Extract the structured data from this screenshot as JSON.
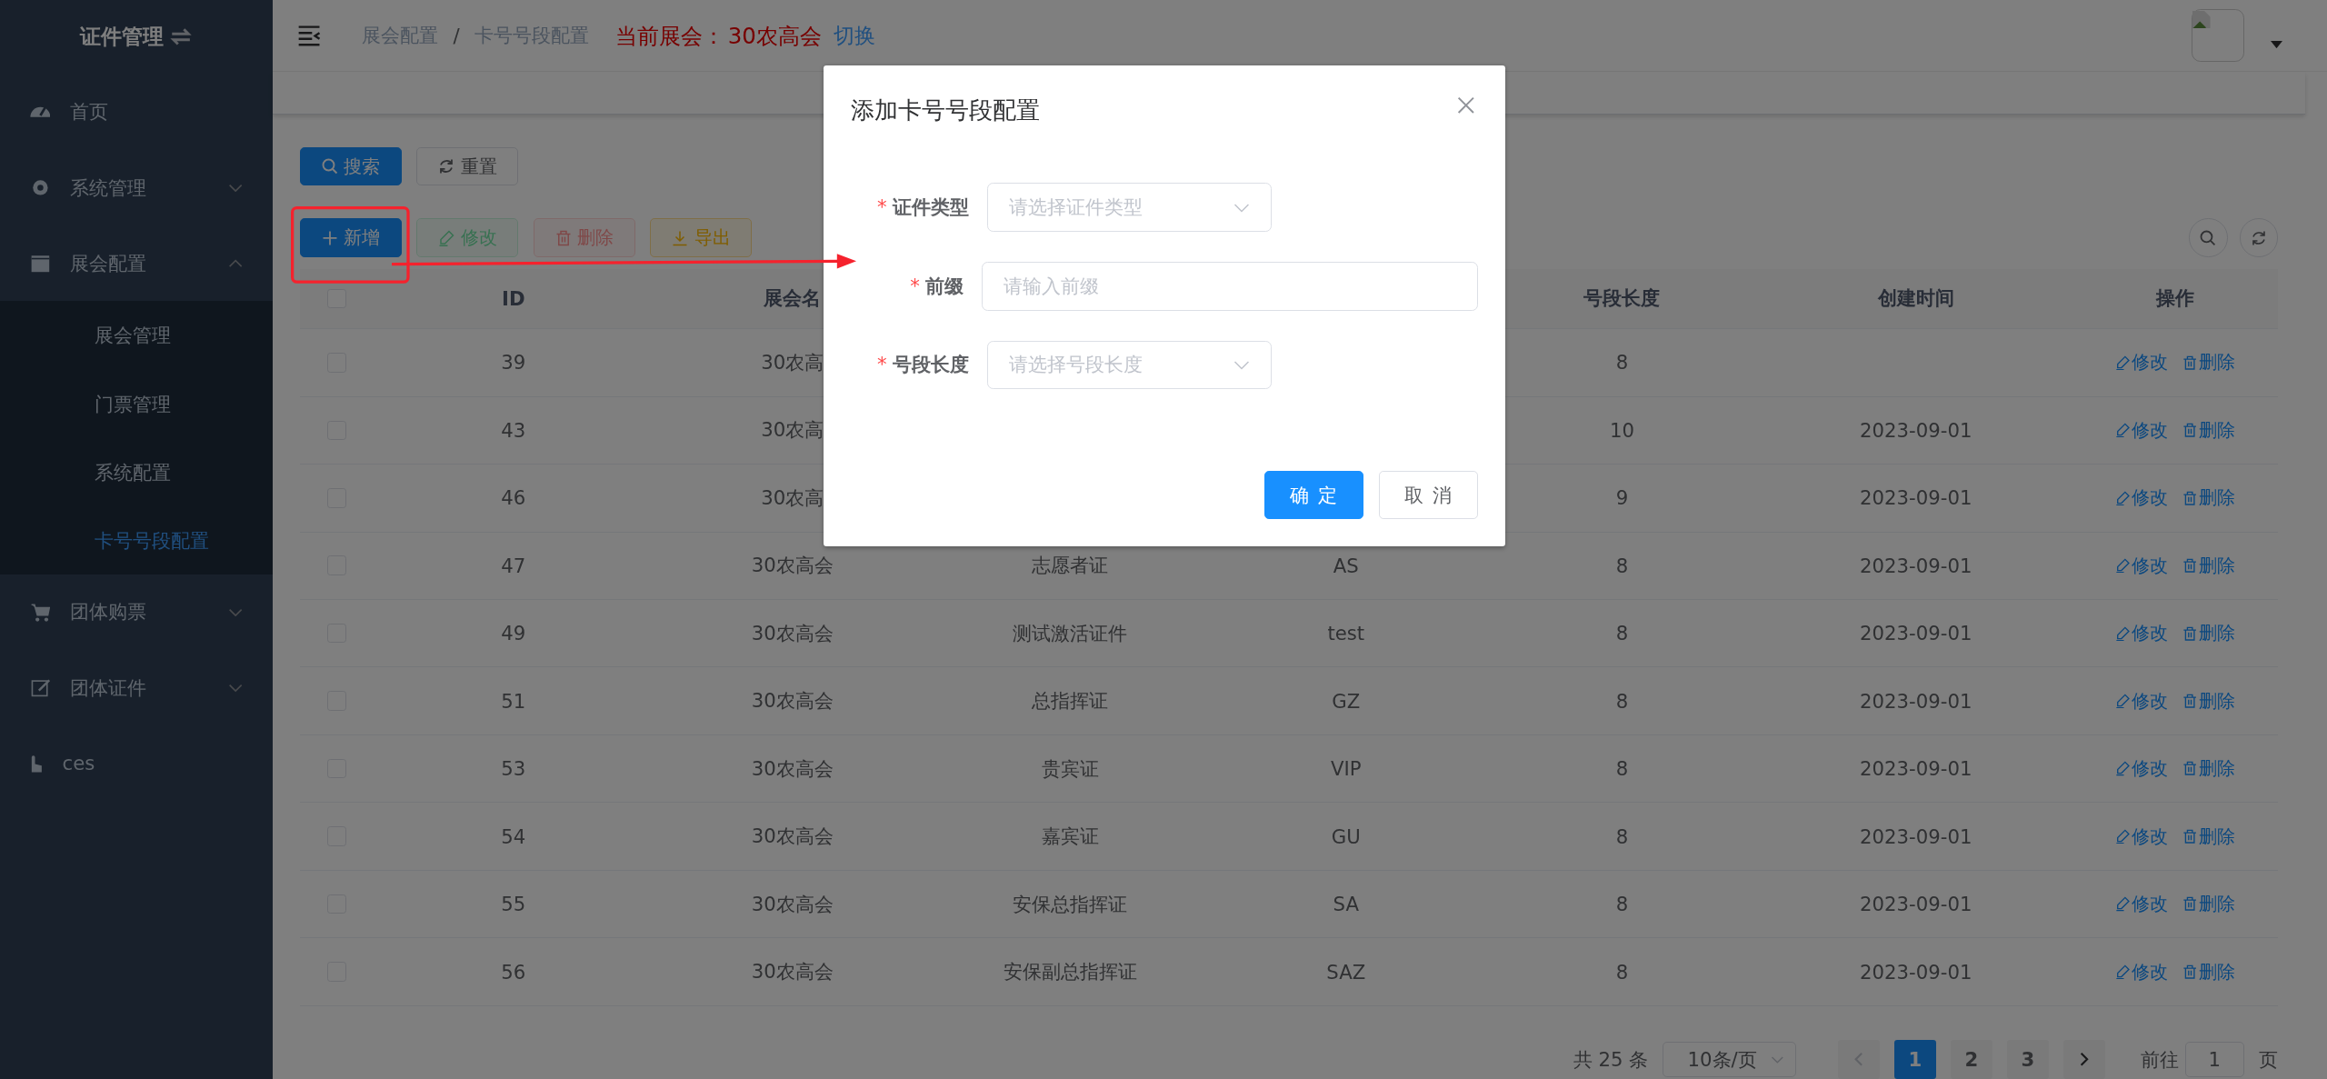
{
  "sidebar": {
    "title": "证件管理",
    "items": [
      {
        "label": "首页",
        "selected": false
      },
      {
        "label": "系统管理",
        "expanded": false,
        "selected": false
      },
      {
        "label": "展会配置",
        "expanded": true,
        "selected": false,
        "children": [
          {
            "label": "展会管理",
            "selected": false
          },
          {
            "label": "门票管理",
            "selected": false
          },
          {
            "label": "系统配置",
            "selected": false
          },
          {
            "label": "卡号号段配置",
            "selected": true
          }
        ]
      },
      {
        "label": "团体购票",
        "expanded": false,
        "selected": false
      },
      {
        "label": "团体证件",
        "expanded": false,
        "selected": false
      },
      {
        "label": "ces",
        "selected": false
      }
    ]
  },
  "header": {
    "breadcrumb": [
      "展会配置",
      "卡号号段配置"
    ],
    "breadcrumb_separator": "/",
    "current_label": "当前展会：",
    "current_value": "30农高会",
    "switch_link": "切换"
  },
  "search_buttons": [
    {
      "label": "搜索",
      "kind": "primary"
    },
    {
      "label": "重置",
      "kind": "default"
    }
  ],
  "toolbar_buttons": [
    {
      "label": "新增",
      "kind": "primary",
      "disabled": false
    },
    {
      "label": "修改",
      "kind": "success",
      "disabled": true
    },
    {
      "label": "删除",
      "kind": "danger",
      "disabled": true
    },
    {
      "label": "导出",
      "kind": "warning",
      "disabled": false
    }
  ],
  "table": {
    "select_all_checked": false,
    "headers": {
      "id": "ID",
      "exhibition": "展会名",
      "length": "号段长度",
      "created": "创建时间",
      "actions": "操作"
    },
    "rows": [
      {
        "checked": false,
        "id": "39",
        "exhibition": "30农高",
        "length": "8",
        "actions": [
          "修改",
          "删除"
        ]
      },
      {
        "checked": false,
        "id": "43",
        "exhibition": "30农高",
        "length": "10",
        "created": "2023-09-01",
        "actions": [
          "修改",
          "删除"
        ]
      },
      {
        "checked": false,
        "id": "46",
        "exhibition": "30农高",
        "length": "9",
        "created": "2023-09-01",
        "actions": [
          "修改",
          "删除"
        ]
      },
      {
        "checked": false,
        "id": "47",
        "exhibition": "30农高会",
        "type": "志愿者证",
        "prefix": "AS",
        "length": "8",
        "created": "2023-09-01",
        "actions": [
          "修改",
          "删除"
        ]
      },
      {
        "checked": false,
        "id": "49",
        "exhibition": "30农高会",
        "type": "测试激活证件",
        "prefix": "test",
        "length": "8",
        "created": "2023-09-01",
        "actions": [
          "修改",
          "删除"
        ]
      },
      {
        "checked": false,
        "id": "51",
        "exhibition": "30农高会",
        "type": "总指挥证",
        "prefix": "GZ",
        "length": "8",
        "created": "2023-09-01",
        "actions": [
          "修改",
          "删除"
        ]
      },
      {
        "checked": false,
        "id": "53",
        "exhibition": "30农高会",
        "type": "贵宾证",
        "prefix": "VIP",
        "length": "8",
        "created": "2023-09-01",
        "actions": [
          "修改",
          "删除"
        ]
      },
      {
        "checked": false,
        "id": "54",
        "exhibition": "30农高会",
        "type": "嘉宾证",
        "prefix": "GU",
        "length": "8",
        "created": "2023-09-01",
        "actions": [
          "修改",
          "删除"
        ]
      },
      {
        "checked": false,
        "id": "55",
        "exhibition": "30农高会",
        "type": "安保总指挥证",
        "prefix": "SA",
        "length": "8",
        "created": "2023-09-01",
        "actions": [
          "修改",
          "删除"
        ]
      },
      {
        "checked": false,
        "id": "56",
        "exhibition": "30农高会",
        "type": "安保副总指挥证",
        "prefix": "SAZ",
        "length": "8",
        "created": "2023-09-01",
        "actions": [
          "修改",
          "删除"
        ]
      }
    ]
  },
  "pagination": {
    "total": "共 25 条",
    "page_size": "10条/页",
    "pages": [
      {
        "label": "1",
        "selected": true
      },
      {
        "label": "2",
        "selected": false
      },
      {
        "label": "3",
        "selected": false
      }
    ],
    "goto_label": "前往",
    "goto_value": "1",
    "page_suffix": "页"
  },
  "dialog": {
    "title": "添加卡号号段配置",
    "fields": [
      {
        "label": "证件类型",
        "required_mark": "*",
        "kind": "select",
        "placeholder": "请选择证件类型"
      },
      {
        "label": "前缀",
        "required_mark": "*",
        "kind": "input",
        "placeholder": "请输入前缀"
      },
      {
        "label": "号段长度",
        "required_mark": "*",
        "kind": "select",
        "placeholder": "请选择号段长度"
      }
    ],
    "buttons": [
      {
        "label": "确 定",
        "kind": "primary"
      },
      {
        "label": "取 消",
        "kind": "default"
      }
    ]
  }
}
